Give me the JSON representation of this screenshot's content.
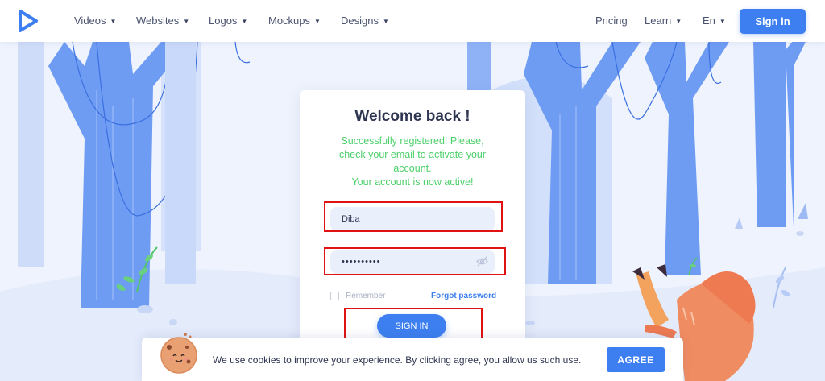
{
  "nav": {
    "items": [
      {
        "label": "Videos"
      },
      {
        "label": "Websites"
      },
      {
        "label": "Logos"
      },
      {
        "label": "Mockups"
      },
      {
        "label": "Designs"
      }
    ],
    "pricing": "Pricing",
    "learn": "Learn",
    "language": "En",
    "signin": "Sign in"
  },
  "login": {
    "title": "Welcome back !",
    "message_lines": [
      "Successfully registered! Please,",
      "check your email to activate your",
      "account.",
      "Your account is now active!"
    ],
    "username_value": "Diba",
    "password_value": "••••••••••",
    "remember_label": "Remember",
    "forgot_label": "Forgot password",
    "signin_label": "SIGN IN"
  },
  "cookie": {
    "text": "We use cookies to improve your experience. By clicking agree, you allow us such use.",
    "agree_label": "AGREE"
  },
  "colors": {
    "accent": "#3d7ff0",
    "success": "#4cd06a",
    "highlight": "#e01212",
    "tree": "#6f9cf3",
    "background": "#eef3fd"
  }
}
